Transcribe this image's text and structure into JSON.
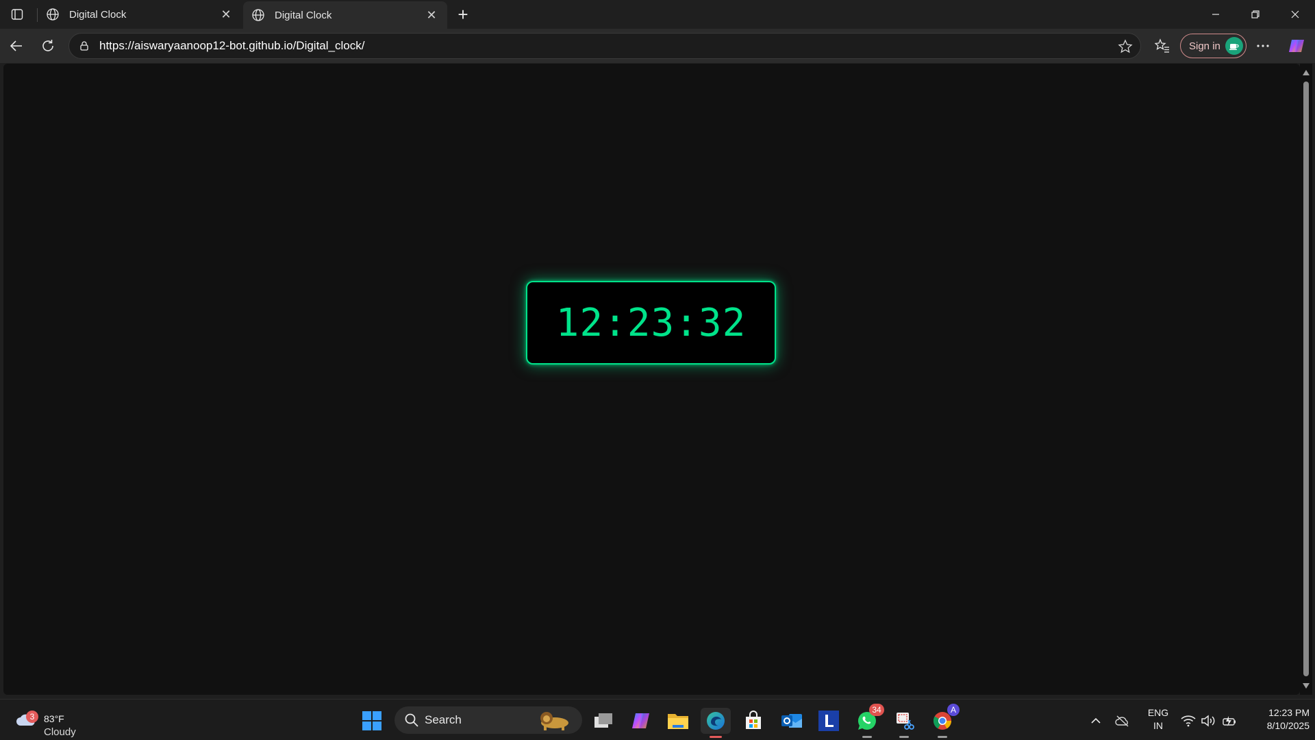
{
  "browser": {
    "tabs": [
      {
        "title": "Digital Clock",
        "active": false
      },
      {
        "title": "Digital Clock",
        "active": true
      }
    ],
    "url": "https://aiswaryaanoop12-bot.github.io/Digital_clock/",
    "signin_label": "Sign in"
  },
  "page": {
    "clock_time": "12:23:32",
    "clock_color": "#00e38a",
    "background_color": "#111111"
  },
  "taskbar": {
    "weather": {
      "temp": "83°F",
      "condition": "Cloudy",
      "badge": "3"
    },
    "search_label": "Search",
    "apps": [
      {
        "name": "task-view-icon"
      },
      {
        "name": "copilot-icon"
      },
      {
        "name": "file-explorer-icon"
      },
      {
        "name": "edge-icon"
      },
      {
        "name": "microsoft-store-icon"
      },
      {
        "name": "outlook-icon"
      },
      {
        "name": "l-app-icon"
      },
      {
        "name": "whatsapp-icon",
        "badge": "34"
      },
      {
        "name": "snipping-tool-icon"
      },
      {
        "name": "chrome-icon",
        "badge": "A"
      }
    ],
    "language": {
      "line1": "ENG",
      "line2": "IN"
    },
    "time": "12:23 PM",
    "date": "8/10/2025"
  }
}
